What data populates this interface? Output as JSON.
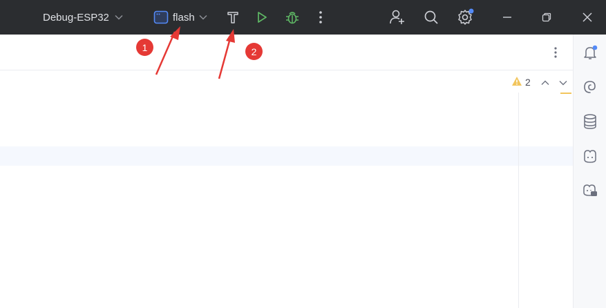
{
  "titlebar": {
    "config_name": "Debug-ESP32",
    "run_config": "flash",
    "colors": {
      "background": "#2b2d30",
      "text": "#dfe1e5",
      "run_green": "#5fb865",
      "notify_blue": "#548af7",
      "accent_blue": "#3574f0"
    },
    "icons": {
      "config_dropdown": "chevron-down-icon",
      "run_config": "run-config-window-icon",
      "build": "hammer-icon",
      "run": "play-icon",
      "debug": "bug-icon",
      "more": "more-vertical-icon",
      "collab": "add-user-icon",
      "search": "search-icon",
      "settings": "gear-icon",
      "minimize": "minimize-icon",
      "restore": "restore-icon",
      "close": "close-icon"
    }
  },
  "editor": {
    "inspection_count": "2",
    "icons": {
      "warning": "warning-icon",
      "prev": "chevron-up-icon",
      "next": "chevron-down-icon",
      "more": "more-vertical-icon"
    }
  },
  "right_strip": {
    "icons": [
      "notifications-icon",
      "ai-assistant-icon",
      "database-icon",
      "copilot-icon",
      "copilot-chat-icon"
    ]
  },
  "annotations": [
    {
      "label": "1",
      "color": "#e53935"
    },
    {
      "label": "2",
      "color": "#e53935"
    }
  ]
}
